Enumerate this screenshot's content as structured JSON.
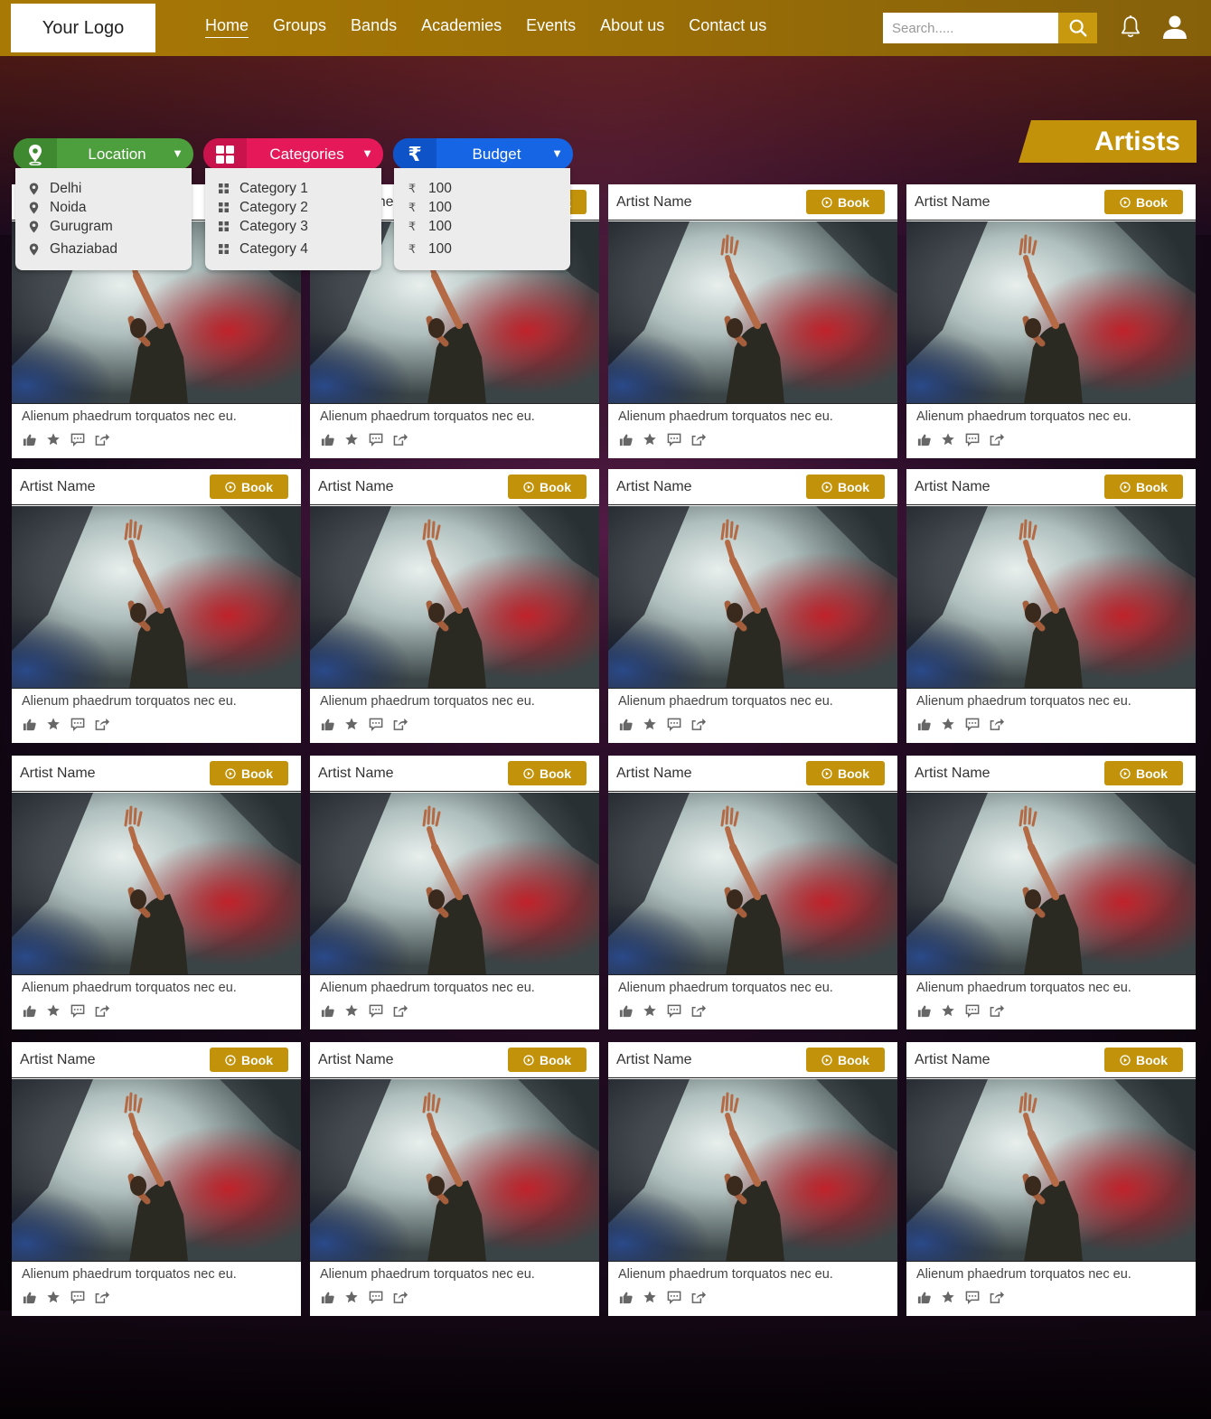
{
  "header": {
    "logo_text": "Your Logo",
    "nav": [
      "Home",
      "Groups",
      "Bands",
      "Academies",
      "Events",
      "About us",
      "Contact us"
    ],
    "active_nav": "Home",
    "search_placeholder": "Search.....",
    "brand_color": "#a97905"
  },
  "section_title": "Artists",
  "filters": {
    "location": {
      "label": "Location",
      "color": "#4d9e3c",
      "items": [
        "Delhi",
        "Noida",
        "Gurugram",
        "Ghaziabad"
      ]
    },
    "categories": {
      "label": "Categories",
      "color": "#e5195a",
      "items": [
        "Category 1",
        "Category 2",
        "Category 3",
        "Category 4"
      ]
    },
    "budget": {
      "label": "Budget",
      "color": "#1565e4",
      "currency_symbol": "₹",
      "items": [
        "100",
        "100",
        "100",
        "100"
      ]
    }
  },
  "cards": {
    "artist_name": "Artist Name",
    "book_label": "Book",
    "description": "Alienum phaedrum torquatos nec eu.",
    "rows": 4,
    "columns": 4,
    "actions": [
      "like-icon",
      "star-icon",
      "comment-icon",
      "share-icon"
    ]
  }
}
